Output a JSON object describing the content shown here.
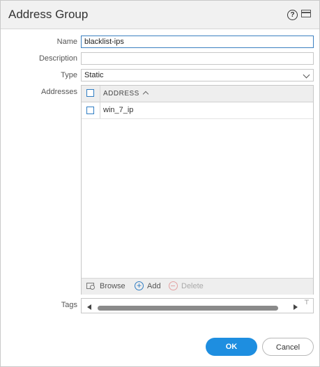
{
  "dialog": {
    "title": "Address Group"
  },
  "form": {
    "name_label": "Name",
    "name_value": "blacklist-ips",
    "description_label": "Description",
    "description_value": "",
    "type_label": "Type",
    "type_value": "Static",
    "addresses_label": "Addresses",
    "tags_label": "Tags"
  },
  "grid": {
    "column_header": "ADDRESS",
    "rows": [
      {
        "address": "win_7_ip",
        "checked": false
      }
    ],
    "actions": {
      "browse": "Browse",
      "add": "Add",
      "delete": "Delete"
    }
  },
  "buttons": {
    "ok": "OK",
    "cancel": "Cancel"
  },
  "colors": {
    "accent": "#1e8ee0",
    "checkbox": "#2f7dc3"
  }
}
